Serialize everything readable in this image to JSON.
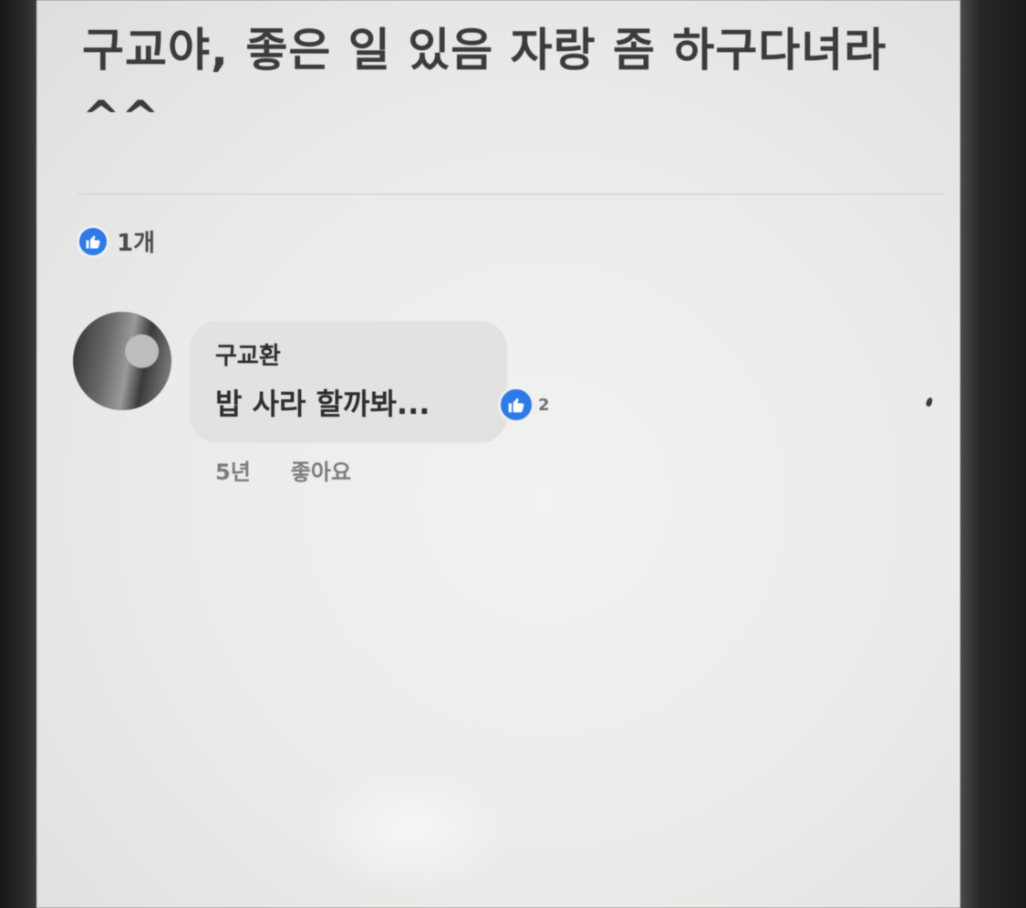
{
  "post": {
    "text": "구교야, 좋은 일 있음 자랑 좀 하구다녀라^^"
  },
  "reactions": {
    "count_label": "1개",
    "icon": "thumbs-up-icon"
  },
  "comment": {
    "author": "구교환",
    "body": "밥 사라 할까봐...",
    "reaction_count": "2",
    "reaction_icon": "thumbs-up-icon",
    "time": "5년",
    "like_label": "좋아요"
  },
  "colors": {
    "like_blue": "#2d7be8",
    "bubble": "#e2e2e0",
    "text_dark": "#2c2d2e"
  }
}
